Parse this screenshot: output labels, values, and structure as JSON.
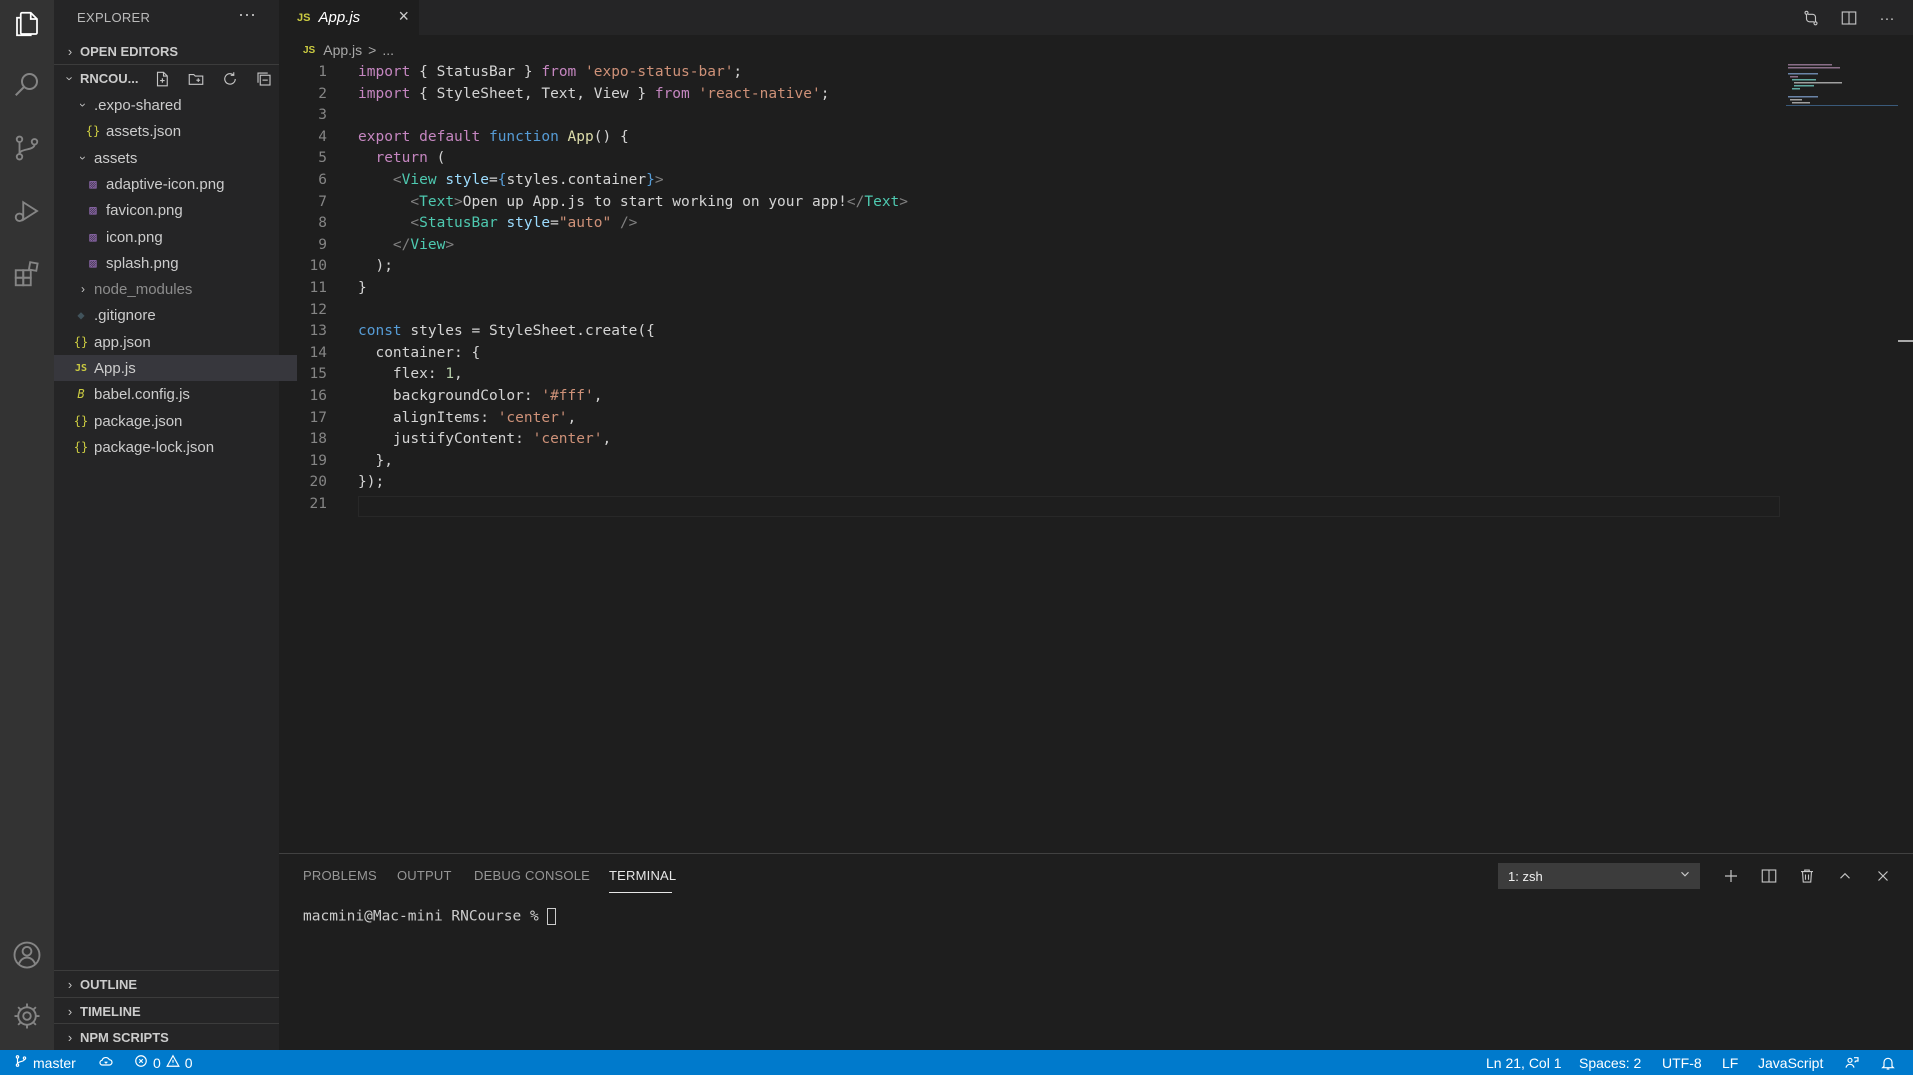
{
  "sidebar": {
    "title": "EXPLORER",
    "more": "···",
    "open_editors": "OPEN EDITORS",
    "project": "RNCOU...",
    "tree": [
      {
        "label": ".expo-shared",
        "kind": "folder-open"
      },
      {
        "label": "assets.json",
        "kind": "json"
      },
      {
        "label": "assets",
        "kind": "folder-open"
      },
      {
        "label": "adaptive-icon.png",
        "kind": "image"
      },
      {
        "label": "favicon.png",
        "kind": "image"
      },
      {
        "label": "icon.png",
        "kind": "image"
      },
      {
        "label": "splash.png",
        "kind": "image"
      },
      {
        "label": "node_modules",
        "kind": "folder-closed"
      },
      {
        "label": ".gitignore",
        "kind": "git"
      },
      {
        "label": "app.json",
        "kind": "json"
      },
      {
        "label": "App.js",
        "kind": "js"
      },
      {
        "label": "babel.config.js",
        "kind": "babel"
      },
      {
        "label": "package.json",
        "kind": "json"
      },
      {
        "label": "package-lock.json",
        "kind": "json"
      }
    ],
    "outline": "OUTLINE",
    "timeline": "TIMELINE",
    "npm_scripts": "NPM SCRIPTS"
  },
  "tabs": {
    "active_label": "App.js",
    "js_badge": "JS",
    "close": "×"
  },
  "breadcrumb": {
    "file": "App.js",
    "sep": ">",
    "rest": "..."
  },
  "editor": {
    "line_numbers": [
      "1",
      "2",
      "3",
      "4",
      "5",
      "6",
      "7",
      "8",
      "9",
      "10",
      "11",
      "12",
      "13",
      "14",
      "15",
      "16",
      "17",
      "18",
      "19",
      "20",
      "21"
    ],
    "tokens": {
      "import": "import",
      "from": "from",
      "export": "export",
      "default": "default",
      "function": "function",
      "return": "return",
      "const": "const",
      "statusbar_pkg": "'expo-status-bar'",
      "rn_pkg": "'react-native'",
      "open_brace_statusbar": "{ StatusBar }",
      "rn_imports": "{ StyleSheet, Text, View }",
      "app_fn": "App",
      "view_tag": "View",
      "text_tag": "Text",
      "statusbar_tag": "StatusBar",
      "style_attr": "style",
      "styles_container": "styles.container",
      "text_content": "Open up App.js to start working on your app!",
      "auto_str": "\"auto\"",
      "styles_var": "styles",
      "stylesheet_create": "StyleSheet.create",
      "container_key": "container",
      "flex_key": "flex",
      "flex_val": "1",
      "bg_key": "backgroundColor",
      "bg_val": "'#fff'",
      "align_key": "alignItems",
      "align_val": "'center'",
      "justify_key": "justifyContent",
      "justify_val": "'center'"
    }
  },
  "panel": {
    "tabs": [
      "PROBLEMS",
      "OUTPUT",
      "DEBUG CONSOLE",
      "TERMINAL"
    ],
    "active_tab": "TERMINAL",
    "terminal_select": "1: zsh",
    "prompt": "macmini@Mac-mini RNCourse % "
  },
  "statusbar": {
    "branch": "master",
    "errors": "0",
    "warnings": "0",
    "position": "Ln 21, Col 1",
    "spaces": "Spaces: 2",
    "encoding": "UTF-8",
    "eol": "LF",
    "language": "JavaScript"
  },
  "colors": {
    "accent": "#007acc",
    "keyword": "#569cd6",
    "string": "#ce9178",
    "tag": "#4ec9b0"
  }
}
